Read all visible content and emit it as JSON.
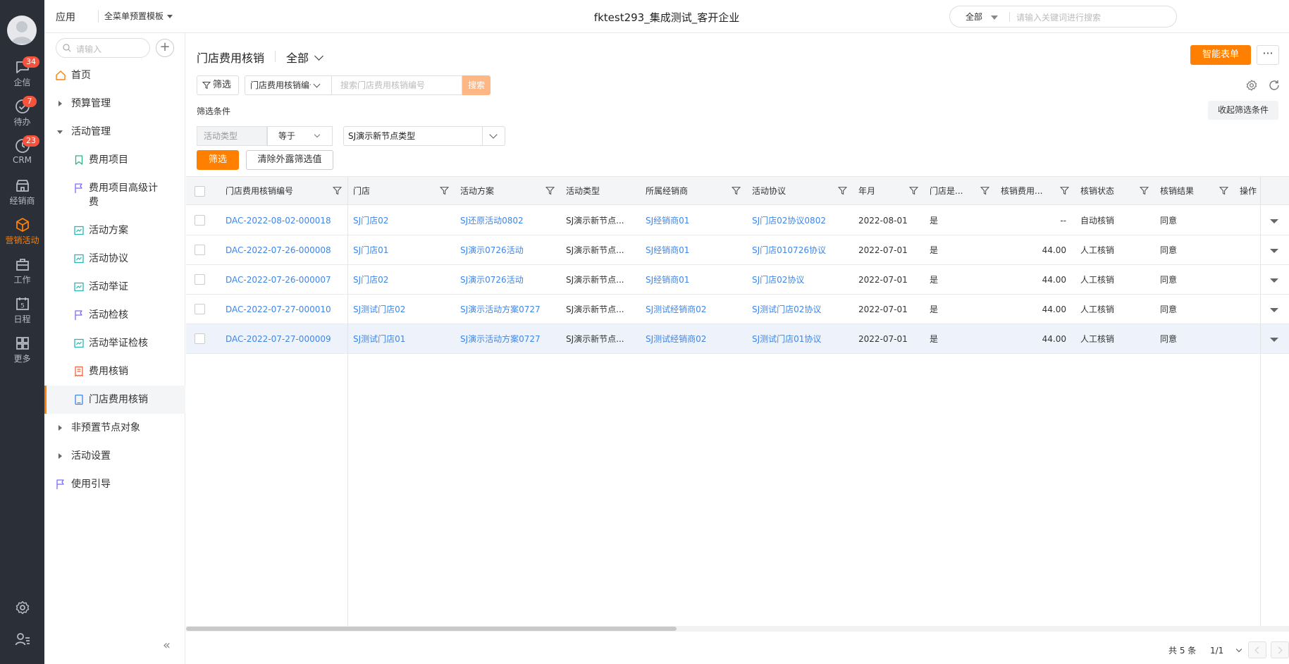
{
  "rail": {
    "items": [
      {
        "label": "企信",
        "badge": "34"
      },
      {
        "label": "待办",
        "badge": "7"
      },
      {
        "label": "CRM",
        "badge": "23"
      },
      {
        "label": "经销商",
        "badge": ""
      },
      {
        "label": "营销活动",
        "badge": ""
      },
      {
        "label": "工作",
        "badge": ""
      },
      {
        "label": "日程",
        "badge": ""
      },
      {
        "label": "更多",
        "badge": ""
      }
    ],
    "calendar_day": "5",
    "accent": "#ff8000"
  },
  "header": {
    "app_label": "应用",
    "template": "全菜单预置模板",
    "tenant": "fktest293_集成测试_客开企业",
    "search_scope": "全部",
    "search_placeholder": "请输入关键词进行搜索"
  },
  "nav": {
    "search_placeholder": "请输入",
    "items": [
      {
        "label": "首页"
      },
      {
        "label": "预算管理"
      },
      {
        "label": "活动管理"
      },
      {
        "label": "费用项目"
      },
      {
        "label": "费用项目高级计费"
      },
      {
        "label": "活动方案"
      },
      {
        "label": "活动协议"
      },
      {
        "label": "活动举证"
      },
      {
        "label": "活动检核"
      },
      {
        "label": "活动举证检核"
      },
      {
        "label": "费用核销"
      },
      {
        "label": "门店费用核销"
      },
      {
        "label": "非预置节点对象"
      },
      {
        "label": "活动设置"
      },
      {
        "label": "使用引导"
      }
    ]
  },
  "page": {
    "title": "门店费用核销",
    "scope": "全部",
    "smart_form": "智能表单",
    "more": "···"
  },
  "toolbar": {
    "filter_label": "筛选",
    "field_select": "门店费用核销编号",
    "search_placeholder": "搜索门店费用核销编号",
    "search_button": "搜索"
  },
  "conditions": {
    "title": "筛选条件",
    "collapse": "收起筛选条件",
    "field": "活动类型",
    "operator": "等于",
    "value": "SJ演示新节点类型",
    "apply": "筛选",
    "clear": "清除外露筛选值"
  },
  "table": {
    "columns": [
      "门店费用核销编号",
      "门店",
      "活动方案",
      "活动类型",
      "所属经销商",
      "活动协议",
      "年月",
      "门店是...",
      "核销费用...",
      "核销状态",
      "核销结果",
      "操作"
    ],
    "rows": [
      [
        "DAC-2022-08-02-000018",
        "SJ门店02",
        "SJ还原活动0802",
        "SJ演示新节点...",
        "SJ经销商01",
        "SJ门店02协议0802",
        "2022-08-01",
        "是",
        "--",
        "自动核销",
        "同意"
      ],
      [
        "DAC-2022-07-26-000008",
        "SJ门店01",
        "SJ演示0726活动",
        "SJ演示新节点...",
        "SJ经销商01",
        "SJ门店010726协议",
        "2022-07-01",
        "是",
        "44.00",
        "人工核销",
        "同意"
      ],
      [
        "DAC-2022-07-26-000007",
        "SJ门店02",
        "SJ演示0726活动",
        "SJ演示新节点...",
        "SJ经销商01",
        "SJ门店02协议",
        "2022-07-01",
        "是",
        "44.00",
        "人工核销",
        "同意"
      ],
      [
        "DAC-2022-07-27-000010",
        "SJ测试门店02",
        "SJ演示活动方案0727",
        "SJ演示新节点...",
        "SJ测试经销商02",
        "SJ测试门店02协议",
        "2022-07-01",
        "是",
        "44.00",
        "人工核销",
        "同意"
      ],
      [
        "DAC-2022-07-27-000009",
        "SJ测试门店01",
        "SJ演示活动方案0727",
        "SJ演示新节点...",
        "SJ测试经销商02",
        "SJ测试门店01协议",
        "2022-07-01",
        "是",
        "44.00",
        "人工核销",
        "同意"
      ]
    ],
    "link_color": "#3e86e8"
  },
  "pagination": {
    "total": "共 5 条",
    "page": "1/1"
  }
}
